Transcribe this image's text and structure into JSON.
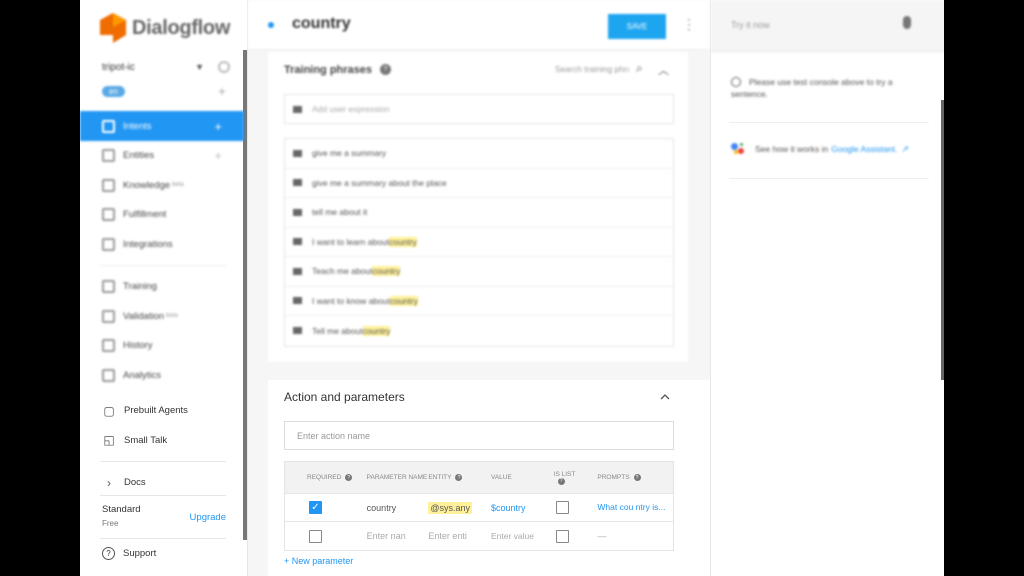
{
  "app": {
    "brand": "Dialogflow",
    "accent": "#2196f3"
  },
  "sidebar": {
    "agent_name": "tripot-ic",
    "language": "en",
    "nav_items": [
      {
        "label": "Intents",
        "icon": "chat-icon",
        "active": true
      },
      {
        "label": "Entities",
        "icon": "entities-icon"
      },
      {
        "label": "Knowledge",
        "icon": "knowledge-icon",
        "badge": "beta"
      },
      {
        "label": "Fulfillment",
        "icon": "bolt-icon"
      },
      {
        "label": "Integrations",
        "icon": "integrations-icon"
      },
      {
        "label": "Training",
        "icon": "training-icon"
      },
      {
        "label": "Validation",
        "icon": "validation-icon",
        "badge": "beta"
      },
      {
        "label": "History",
        "icon": "clock-icon"
      },
      {
        "label": "Analytics",
        "icon": "chart-icon"
      }
    ],
    "lower_items": [
      {
        "label": "Prebuilt Agents",
        "icon": "book-icon"
      },
      {
        "label": "Small Talk",
        "icon": "chat-bubbles-icon"
      },
      {
        "label": "Docs",
        "icon": "chevron-right-icon"
      }
    ],
    "plan": {
      "name": "Standard",
      "sub": "Free",
      "upgrade": "Upgrade"
    },
    "support": "Support"
  },
  "main": {
    "intent_name": "country",
    "save_label": "SAVE",
    "training": {
      "title": "Training phrases",
      "search_placeholder": "Search training phrases",
      "add_placeholder": "Add user expression",
      "phrases": [
        {
          "pre": "give me a summary",
          "hl": "",
          "post": ""
        },
        {
          "pre": "give me a summary about the place",
          "hl": "",
          "post": ""
        },
        {
          "pre": "tell me about it",
          "hl": "",
          "post": ""
        },
        {
          "pre": "I want to learn about ",
          "hl": "country",
          "post": ""
        },
        {
          "pre": "Teach me about ",
          "hl": "country",
          "post": ""
        },
        {
          "pre": "I want to know about ",
          "hl": "country",
          "post": ""
        },
        {
          "pre": "Tell me about ",
          "hl": "country",
          "post": ""
        }
      ]
    },
    "action": {
      "title": "Action and parameters",
      "action_placeholder": "Enter action name",
      "headers": {
        "required": "REQUIRED",
        "param_name": "PARAMETER NAME",
        "entity": "ENTITY",
        "value": "VALUE",
        "is_list": "IS LIST",
        "prompts": "PROMPTS"
      },
      "row1": {
        "name": "country",
        "entity": "@sys.any",
        "value": "$country",
        "prompts": "What cou ntry is..."
      },
      "row2": {
        "name_ph": "Enter nan",
        "entity_ph": "Enter enti",
        "value_ph": "Enter value",
        "prompts": "—"
      },
      "new_param": "+ New parameter"
    }
  },
  "right": {
    "try_placeholder": "Try it now",
    "hint": "Please use test console above to try a sentence.",
    "ga_pre": "See how it works in",
    "ga_link": "Google Assistant."
  }
}
